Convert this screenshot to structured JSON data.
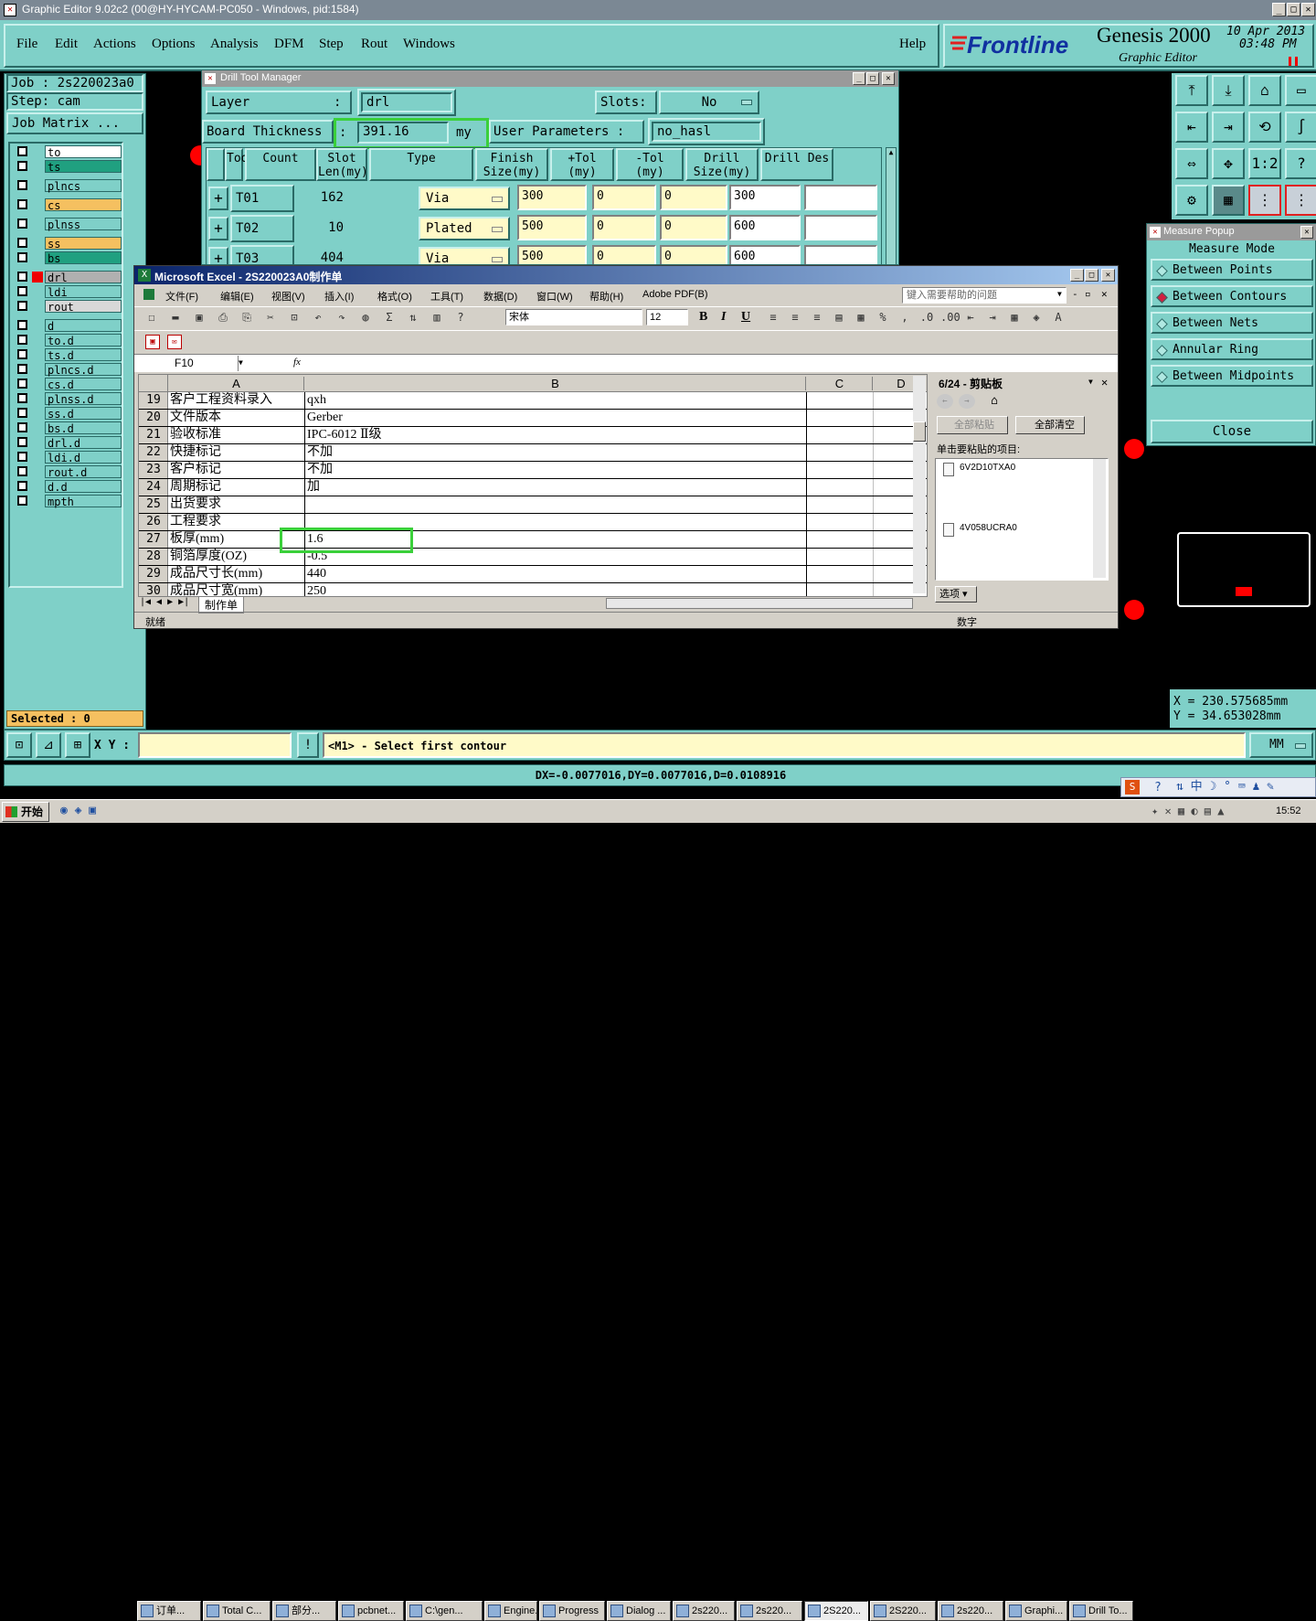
{
  "app": {
    "title": "Graphic Editor 9.02c2 (00@HY-HYCAM-PC050 - Windows, pid:1584)"
  },
  "menu": [
    "File",
    "Edit",
    "Actions",
    "Options",
    "Analysis",
    "DFM",
    "Step",
    "Rout",
    "Windows"
  ],
  "help": "Help",
  "brand": {
    "logo": "Frontline",
    "product": "Genesis 2000",
    "sub": "Graphic Editor",
    "date": "10 Apr 2013",
    "time": "03:48 PM"
  },
  "job": {
    "job": "Job : 2s220023a0",
    "step": "Step: cam",
    "matrix": "Job Matrix ..."
  },
  "layers": [
    {
      "name": "to",
      "color": "#ffffff"
    },
    {
      "name": "ts",
      "color": "#20a080"
    },
    {
      "name": "plncs",
      "color": "#7fd0c8"
    },
    {
      "name": "cs",
      "color": "#f5c060"
    },
    {
      "name": "plnss",
      "color": "#7fd0c8"
    },
    {
      "name": "ss",
      "color": "#f5c060"
    },
    {
      "name": "bs",
      "color": "#20a080"
    },
    {
      "name": "drl",
      "color": "#b0b0b0"
    },
    {
      "name": "ldi",
      "color": "#7fd0c8"
    },
    {
      "name": "rout",
      "color": "#d8d8d8"
    },
    {
      "name": "d",
      "color": "#7fd0c8"
    },
    {
      "name": "to.d",
      "color": "#7fd0c8"
    },
    {
      "name": "ts.d",
      "color": "#7fd0c8"
    },
    {
      "name": "plncs.d",
      "color": "#7fd0c8"
    },
    {
      "name": "cs.d",
      "color": "#7fd0c8"
    },
    {
      "name": "plnss.d",
      "color": "#7fd0c8"
    },
    {
      "name": "ss.d",
      "color": "#7fd0c8"
    },
    {
      "name": "bs.d",
      "color": "#7fd0c8"
    },
    {
      "name": "drl.d",
      "color": "#7fd0c8"
    },
    {
      "name": "ldi.d",
      "color": "#7fd0c8"
    },
    {
      "name": "rout.d",
      "color": "#7fd0c8"
    },
    {
      "name": "d.d",
      "color": "#7fd0c8"
    },
    {
      "name": "mpth",
      "color": "#7fd0c8"
    }
  ],
  "selected": "Selected : 0",
  "drill": {
    "title": "Drill Tool Manager",
    "layer_label": "Layer",
    "layer_sep": ":",
    "layer_value": "drl",
    "slots_label": "Slots:",
    "slots_value": "No",
    "board_label": "Board Thickness",
    "board_value": "391.16",
    "board_unit": "my",
    "user_label": "User Parameters :",
    "user_value": "no_hasl",
    "headers": [
      "Tool",
      "Count",
      "Slot Len(my)",
      "Type",
      "Finish Size(my)",
      "+Tol (my)",
      "-Tol (my)",
      "Drill Size(my)",
      "Drill Des"
    ],
    "rows": [
      {
        "tool": "T01",
        "count": "162",
        "type": "Via",
        "finish": "300",
        "ptol": "0",
        "mtol": "0",
        "drill": "300"
      },
      {
        "tool": "T02",
        "count": "10",
        "type": "Plated",
        "finish": "500",
        "ptol": "0",
        "mtol": "0",
        "drill": "600"
      },
      {
        "tool": "T03",
        "count": "404",
        "type": "Via",
        "finish": "500",
        "ptol": "0",
        "mtol": "0",
        "drill": "600"
      }
    ]
  },
  "excel": {
    "title": "Microsoft Excel - 2S220023A0制作单",
    "menu": [
      "文件(F)",
      "编辑(E)",
      "视图(V)",
      "插入(I)",
      "格式(O)",
      "工具(T)",
      "数据(D)",
      "窗口(W)",
      "帮助(H)",
      "Adobe PDF(B)"
    ],
    "help_placeholder": "键入需要帮助的问题",
    "font": "宋体",
    "size": "12",
    "namebox": "F10",
    "fx": "fx",
    "cols": [
      "A",
      "B",
      "C",
      "D"
    ],
    "rows": [
      {
        "n": "19",
        "a": "客户工程资料录入",
        "b": "qxh"
      },
      {
        "n": "20",
        "a": "文件版本",
        "b": "Gerber"
      },
      {
        "n": "21",
        "a": "验收标准",
        "b": "IPC-6012 Ⅱ级"
      },
      {
        "n": "22",
        "a": "快捷标记",
        "b": "不加"
      },
      {
        "n": "23",
        "a": "客户标记",
        "b": "不加"
      },
      {
        "n": "24",
        "a": "周期标记",
        "b": "加"
      },
      {
        "n": "25",
        "a": "出货要求",
        "b": ""
      },
      {
        "n": "26",
        "a": "工程要求",
        "b": ""
      },
      {
        "n": "27",
        "a": "板厚(mm)",
        "b": "1.6"
      },
      {
        "n": "28",
        "a": "铜箔厚度(OZ)",
        "b": "-0.5"
      },
      {
        "n": "29",
        "a": "成品尺寸长(mm)",
        "b": "440"
      },
      {
        "n": "30",
        "a": "成品尺寸宽(mm)",
        "b": "250"
      }
    ],
    "sheet": "制作单",
    "status": "就绪",
    "status_right": "数字",
    "clip": {
      "title": "6/24 - 剪贴板",
      "paste_all": "全部粘贴",
      "clear_all": "全部清空",
      "hint": "单击要粘贴的项目:",
      "items": [
        "6V2D10TXA0",
        "4V058UCRA0"
      ],
      "options": "选项"
    }
  },
  "measure": {
    "title": "Measure Popup",
    "mode": "Measure Mode",
    "items": [
      "Between Points",
      "Between Contours",
      "Between Nets",
      "Annular Ring",
      "Between Midpoints"
    ],
    "close": "Close"
  },
  "coords": {
    "x": "X = 230.575685mm",
    "y": "Y = 34.653028mm"
  },
  "cmd": {
    "xy_label": "X Y :",
    "prompt": "<M1> - Select first contour",
    "units": "MM",
    "info": "DX=-0.0077016,DY=0.0077016,D=0.0108916"
  },
  "taskbar": {
    "start": "开始",
    "time": "15:52",
    "tasks": [
      "订单...",
      "Total C...",
      "部分...",
      "pcbnet...",
      "C:\\gen...",
      "Engine...",
      "Progress",
      "Dialog ...",
      "2s220...",
      "2s220...",
      "2S220...",
      "2S220...",
      "2s220...",
      "Graphi...",
      "Drill To..."
    ]
  }
}
